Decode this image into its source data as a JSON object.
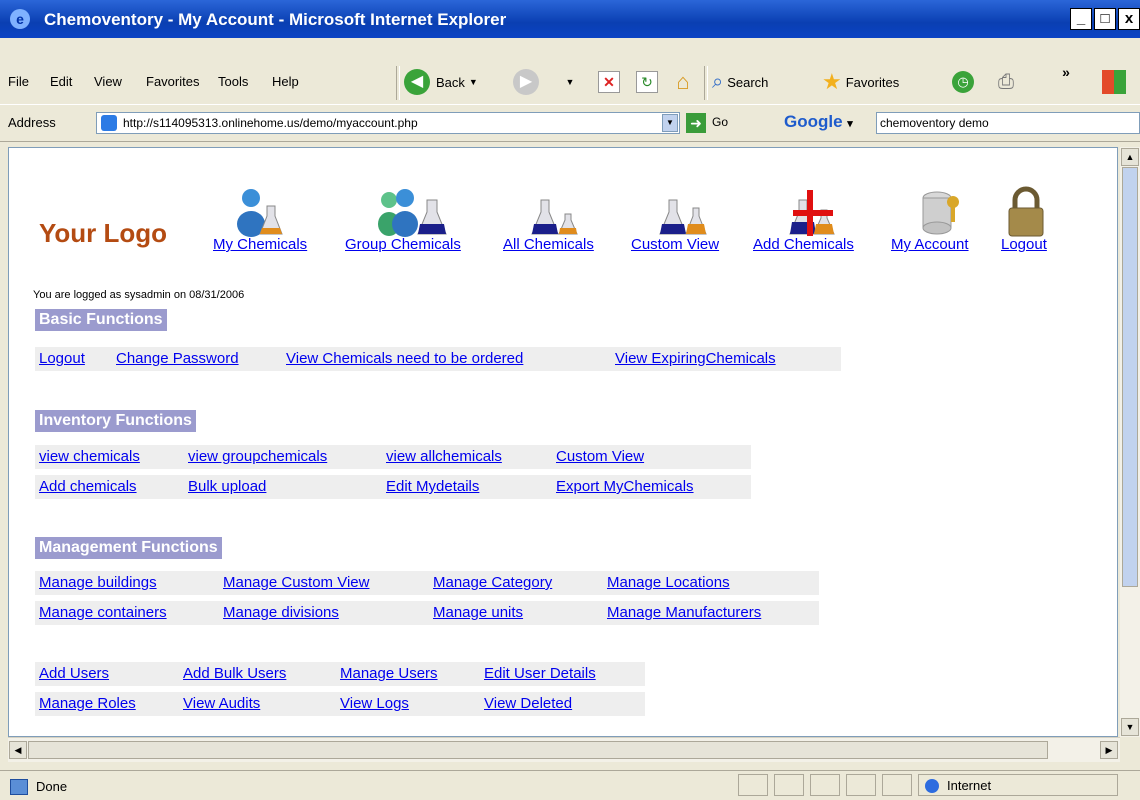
{
  "window": {
    "title": "Chemoventory - My Account - Microsoft Internet Explorer",
    "minimize": "_",
    "maximize": "□",
    "close": "x"
  },
  "menu": [
    "File",
    "Edit",
    "View",
    "Favorites",
    "Tools",
    "Help"
  ],
  "toolbar": {
    "back": "Back",
    "search": "Search",
    "favorites": "Favorites",
    "more": "»"
  },
  "address": {
    "label": "Address",
    "url": "http://s114095313.onlinehome.us/demo/myaccount.php",
    "go": "Go",
    "google": "Google",
    "google_arrow": "▾",
    "search_text": "chemoventory demo"
  },
  "page": {
    "logo": "Your Logo",
    "nav": [
      {
        "label": "My Chemicals",
        "icon": "user-flask-icon"
      },
      {
        "label": "Group Chemicals",
        "icon": "group-flask-icon"
      },
      {
        "label": "All Chemicals",
        "icon": "flasks-icon"
      },
      {
        "label": "Custom View",
        "icon": "flasks-custom-icon"
      },
      {
        "label": "Add Chemicals",
        "icon": "add-flask-icon"
      },
      {
        "label": "My Account",
        "icon": "database-key-icon"
      },
      {
        "label": "Logout",
        "icon": "padlock-icon"
      }
    ],
    "logged_text": "You are logged as sysadmin  on  08/31/2006",
    "basic": {
      "title": "Basic Functions",
      "links": [
        "Logout",
        "Change Password",
        "View Chemicals need to be ordered",
        "View ExpiringChemicals"
      ]
    },
    "inventory": {
      "title": "Inventory Functions",
      "row1": [
        "view chemicals",
        "view groupchemicals",
        "view allchemicals",
        "Custom View"
      ],
      "row2": [
        "Add chemicals",
        "Bulk upload",
        "Edit Mydetails",
        "Export MyChemicals"
      ]
    },
    "management": {
      "title": "Management Functions",
      "row1": [
        "Manage buildings",
        "Manage Custom View",
        "Manage Category",
        "Manage Locations"
      ],
      "row2": [
        "Manage containers",
        "Manage divisions",
        "Manage units",
        "Manage Manufacturers"
      ]
    },
    "users": {
      "row1": [
        "Add Users",
        "Add Bulk Users",
        "Manage Users",
        "Edit User Details"
      ],
      "row2": [
        "Manage Roles",
        "View Audits",
        "View Logs",
        "View Deleted"
      ]
    }
  },
  "status": {
    "text": "Done",
    "zone": "Internet"
  }
}
